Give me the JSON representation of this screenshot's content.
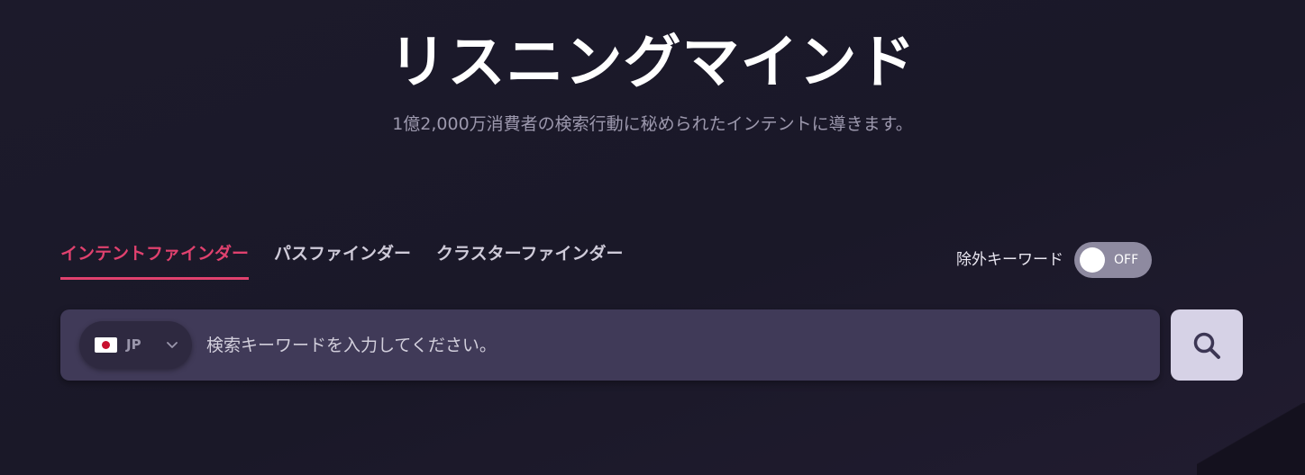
{
  "hero": {
    "title": "リスニングマインド",
    "subtitle": "1億2,000万消費者の検索行動に秘められたインテントに導きます。"
  },
  "tabs": [
    {
      "label": "インテントファインダー",
      "active": true
    },
    {
      "label": "パスファインダー",
      "active": false
    },
    {
      "label": "クラスターファインダー",
      "active": false
    }
  ],
  "exclude_keywords": {
    "label": "除外キーワード",
    "toggle_state": "OFF"
  },
  "search": {
    "country_code": "JP",
    "country_flag_icon": "japan-flag-icon",
    "placeholder": "検索キーワードを入力してください。",
    "value": "",
    "button_icon": "search-icon"
  },
  "colors": {
    "background": "#1c1a2b",
    "accent": "#e0416e",
    "search_bar": "#403a58",
    "search_button": "#d6d2e6",
    "toggle_off": "#8e8aa0"
  }
}
